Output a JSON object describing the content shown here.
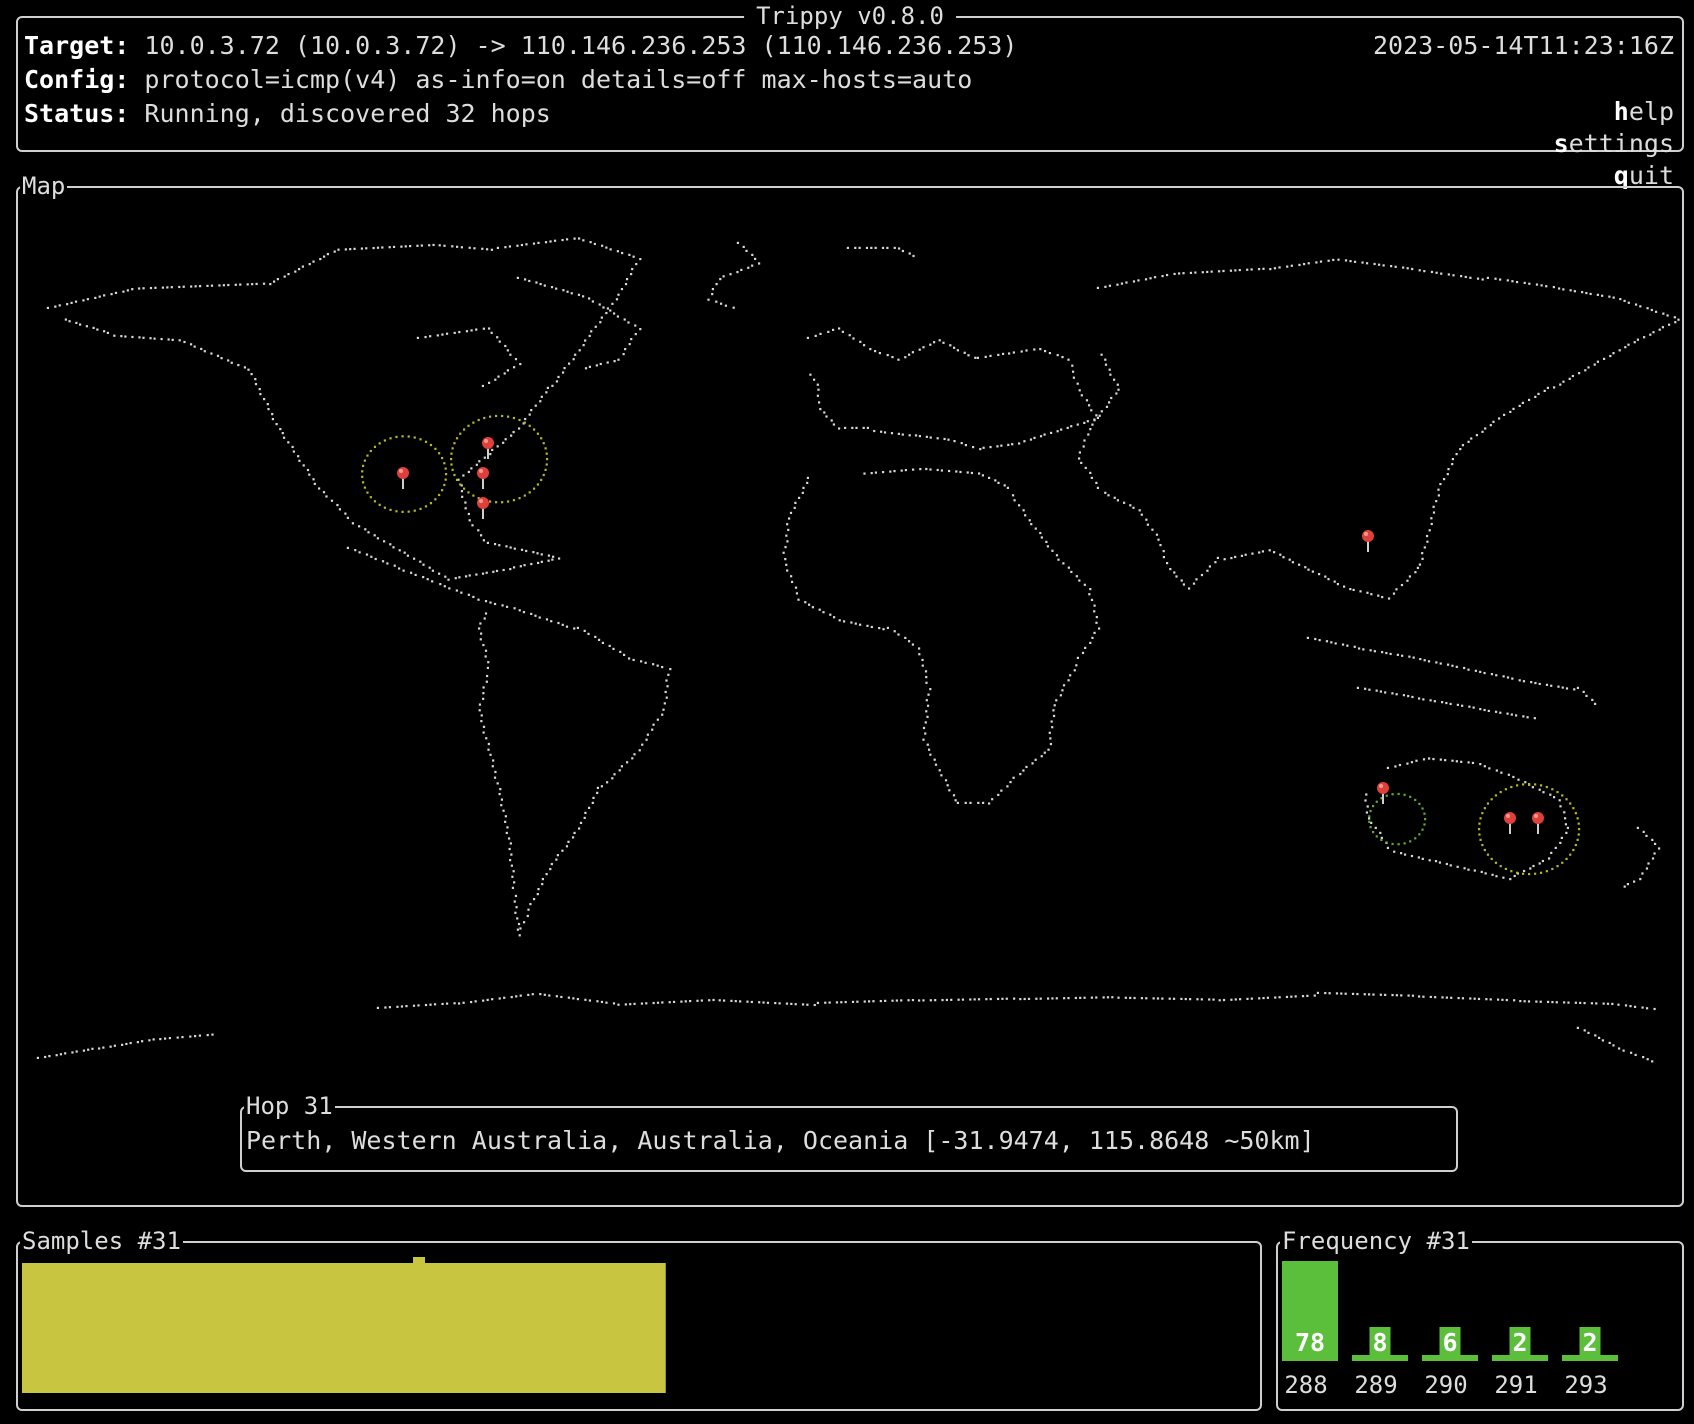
{
  "header": {
    "title": "Trippy v0.8.0",
    "target_label": "Target:",
    "target_value": "10.0.3.72 (10.0.3.72) -> 110.146.236.253 (110.146.236.253)",
    "config_label": "Config:",
    "config_value": "protocol=icmp(v4) as-info=on details=off max-hosts=auto",
    "status_label": "Status:",
    "status_value": "Running, discovered 32 hops",
    "timestamp": "2023-05-14T11:23:16Z",
    "menu": [
      {
        "key": "h",
        "rest": "elp"
      },
      {
        "key": "s",
        "rest": "ettings"
      },
      {
        "key": "q",
        "rest": "uit"
      }
    ]
  },
  "map": {
    "title": "Map",
    "hop_title": "Hop 31",
    "hop_location": "Perth, Western Australia, Australia, Oceania [-31.9474, 115.8648 ~50km]"
  },
  "samples": {
    "title": "Samples #31",
    "bar_color": "#c8c640",
    "fill_fraction": 0.52
  },
  "frequency": {
    "title": "Frequency #31",
    "bar_color": "#5cbf3c",
    "chart_data": {
      "type": "bar",
      "categories": [
        "288",
        "289",
        "290",
        "291",
        "293"
      ],
      "values": [
        78,
        8,
        6,
        2,
        2
      ]
    }
  },
  "colors": {
    "map_dots": "#d8d8d8",
    "yellow_radius": "#b8b820",
    "green_radius": "#6aa82e",
    "pin": "#e0403a"
  }
}
